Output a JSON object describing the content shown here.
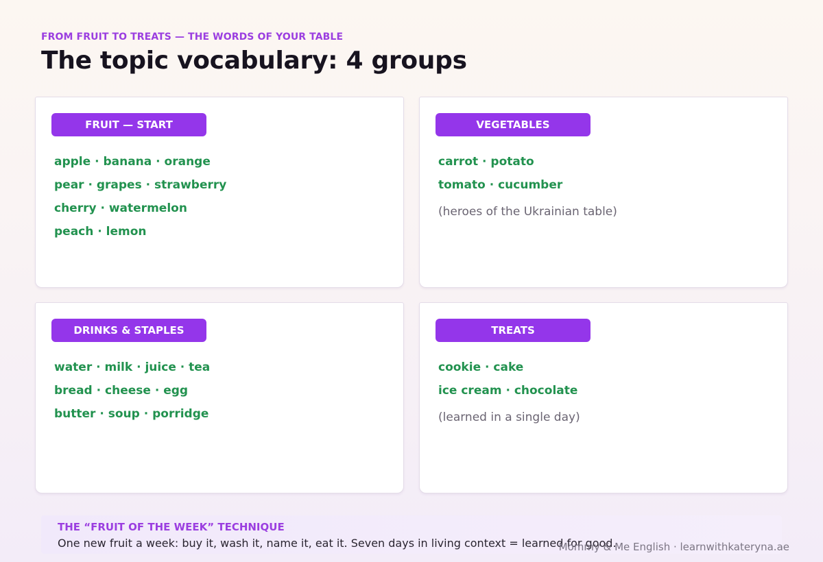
{
  "header": {
    "kicker": "FROM FRUIT TO TREATS — THE WORDS OF YOUR TABLE",
    "title": "The topic vocabulary: 4 groups"
  },
  "groups": [
    {
      "label": "FRUIT — START",
      "lines": [
        "apple · banana · orange",
        "pear · grapes · strawberry",
        "cherry · watermelon",
        "peach · lemon"
      ],
      "note": ""
    },
    {
      "label": "VEGETABLES",
      "lines": [
        "carrot · potato",
        "tomato · cucumber"
      ],
      "note": "(heroes of the Ukrainian table)"
    },
    {
      "label": "DRINKS & STAPLES",
      "lines": [
        "water · milk · juice · tea",
        "bread · cheese · egg",
        "butter · soup · porridge"
      ],
      "note": ""
    },
    {
      "label": "TREATS",
      "lines": [
        "cookie · cake",
        "ice cream · chocolate"
      ],
      "note": "(learned in a single day)"
    }
  ],
  "tip": {
    "title": "THE “FRUIT OF THE WEEK” TECHNIQUE",
    "text": "One new fruit a week: buy it, wash it, name it, eat it. Seven days in living context = learned for good."
  },
  "footer": "Mommy & Me English · learnwithkateryna.ae",
  "colors": {
    "accent": "#9436ea",
    "kicker": "#9b3ee0",
    "word_green": "#22924f",
    "note_gray": "#6a6472"
  }
}
